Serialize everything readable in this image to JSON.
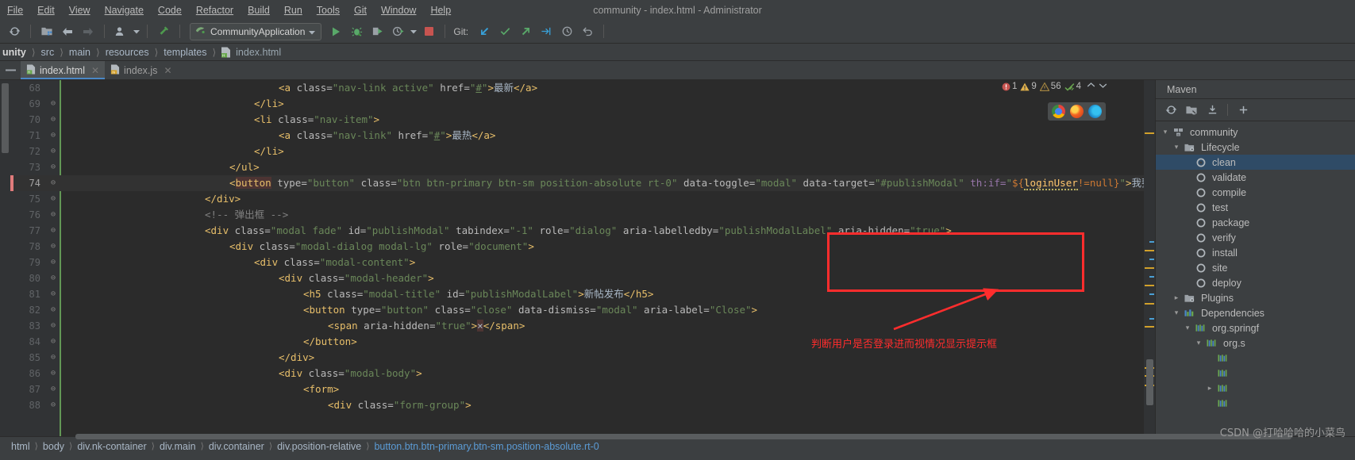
{
  "window": {
    "title": "community - index.html - Administrator"
  },
  "menubar": [
    {
      "label": "File",
      "mnemonic": "F"
    },
    {
      "label": "Edit",
      "mnemonic": "E"
    },
    {
      "label": "View",
      "mnemonic": "V"
    },
    {
      "label": "Navigate",
      "mnemonic": "N"
    },
    {
      "label": "Code",
      "mnemonic": "C"
    },
    {
      "label": "Refactor",
      "mnemonic": "R"
    },
    {
      "label": "Build",
      "mnemonic": "B"
    },
    {
      "label": "Run",
      "mnemonic": "u"
    },
    {
      "label": "Tools",
      "mnemonic": "T"
    },
    {
      "label": "Git",
      "mnemonic": "G"
    },
    {
      "label": "Window",
      "mnemonic": "W"
    },
    {
      "label": "Help",
      "mnemonic": "H"
    }
  ],
  "toolbar": {
    "run_config": "CommunityApplication",
    "git_label": "Git:",
    "icons": [
      "sync-icon",
      "project-structure-icon",
      "back-arrow-icon",
      "forward-arrow-icon",
      "profile-icon",
      "build-hammer-icon",
      "run-icon",
      "debug-icon",
      "run-coverage-icon",
      "profiler-icon",
      "stop-icon",
      "update-project-icon",
      "commit-icon",
      "push-icon",
      "rebase-icon",
      "history-icon",
      "rollback-icon"
    ]
  },
  "pathbar": {
    "crumbs": [
      "unity",
      "src",
      "main",
      "resources",
      "templates"
    ],
    "file": "index.html"
  },
  "tabs": [
    {
      "label": "index.html",
      "type": "html",
      "active": true
    },
    {
      "label": "index.js",
      "type": "js",
      "active": false
    }
  ],
  "inspections": {
    "errors": "1",
    "warnings": "9",
    "weak_warnings": "56",
    "typos": "4"
  },
  "browsers": [
    "chrome-icon",
    "firefox-icon",
    "edge-icon"
  ],
  "editor": {
    "first_line": 68,
    "lines": [
      {
        "n": 68,
        "indent": 0,
        "html": "<span class='t-tag'>&lt;a</span> <span class='t-attr'>class=</span><span class='t-str'>\"nav-link active\"</span> <span class='t-attr'>href=</span><span class='t-str'>\"</span><span class='t-link'>#</span><span class='t-str'>\"</span><span class='t-tag'>&gt;</span><span class='t-cn'>最新</span><span class='t-tag'>&lt;/a&gt;</span>",
        "pad": 268
      },
      {
        "n": 69,
        "indent": 0,
        "html": "<span class='t-tag'>&lt;/li&gt;</span>",
        "pad": 237
      },
      {
        "n": 70,
        "indent": 0,
        "html": "<span class='t-tag'>&lt;li</span> <span class='t-attr'>class=</span><span class='t-str'>\"nav-item\"</span><span class='t-tag'>&gt;</span>",
        "pad": 237
      },
      {
        "n": 71,
        "indent": 0,
        "html": "<span class='t-tag'>&lt;a</span> <span class='t-attr'>class=</span><span class='t-str'>\"nav-link\"</span> <span class='t-attr'>href=</span><span class='t-str'>\"</span><span class='t-link'>#</span><span class='t-str'>\"</span><span class='t-tag'>&gt;</span><span class='t-cn'>最热</span><span class='t-tag'>&lt;/a&gt;</span>",
        "pad": 268
      },
      {
        "n": 72,
        "indent": 0,
        "html": "<span class='t-tag'>&lt;/li&gt;</span>",
        "pad": 237
      },
      {
        "n": 73,
        "indent": 0,
        "html": "<span class='t-tag'>&lt;/ul&gt;</span>",
        "pad": 206
      },
      {
        "n": 74,
        "indent": 0,
        "current": true,
        "html": "<span class='t-tag'>&lt;</span><span class='t-err t-tag'>button</span> <span class='t-attr'>type=</span><span class='t-str'>\"button\"</span> <span class='t-attr'>class=</span><span class='t-str'>\"btn btn-primary btn-sm position-absolute rt-0\"</span> <span class='t-attr'>data-toggle=</span><span class='t-str'>\"modal\"</span> <span class='t-attr'>data-target=</span><span class='t-str'>\"#publishModal\"</span> <span class='t-ns'>th:if=</span><span class='t-str'>\"</span><span class='t-el'>${</span><span class='t-elv t-squig'>loginUser</span><span class='t-el'>!=</span><span class='t-el'>null}</span><span class='t-str'>\"</span><span class='t-tag'>&gt;</span><span class='t-cn'>我要发布</span><span class='t-err t-tag'>&lt;/button</span><span class='t-tag'>&gt;</span>",
        "pad": 206
      },
      {
        "n": 75,
        "indent": 0,
        "html": "<span class='t-tag'>&lt;/div&gt;</span>",
        "pad": 175
      },
      {
        "n": 76,
        "indent": 0,
        "html": "<span class='t-cmt'>&lt;!-- 弹出框 --&gt;</span>",
        "pad": 175
      },
      {
        "n": 77,
        "indent": 0,
        "html": "<span class='t-tag'>&lt;div</span> <span class='t-attr'>class=</span><span class='t-str'>\"modal fade\"</span> <span class='t-attr'>id=</span><span class='t-str'>\"publishModal\"</span> <span class='t-attr'>tabindex=</span><span class='t-str'>\"-1\"</span> <span class='t-attr'>role=</span><span class='t-str'>\"dialog\"</span> <span class='t-attr'>aria-labelledby=</span><span class='t-str'>\"publishModalLabel\"</span> <span class='t-attr'>aria-hidden=</span><span class='t-str'>\"true\"</span><span class='t-tag'>&gt;</span>",
        "pad": 175
      },
      {
        "n": 78,
        "indent": 0,
        "html": "<span class='t-tag'>&lt;div</span> <span class='t-attr'>class=</span><span class='t-str'>\"modal-dialog modal-lg\"</span> <span class='t-attr'>role=</span><span class='t-str'>\"document\"</span><span class='t-tag'>&gt;</span>",
        "pad": 206
      },
      {
        "n": 79,
        "indent": 0,
        "html": "<span class='t-tag'>&lt;div</span> <span class='t-attr'>class=</span><span class='t-str'>\"modal-content\"</span><span class='t-tag'>&gt;</span>",
        "pad": 237
      },
      {
        "n": 80,
        "indent": 0,
        "html": "<span class='t-tag'>&lt;div</span> <span class='t-attr'>class=</span><span class='t-str'>\"modal-header\"</span><span class='t-tag'>&gt;</span>",
        "pad": 268
      },
      {
        "n": 81,
        "indent": 0,
        "html": "<span class='t-tag'>&lt;h5</span> <span class='t-attr'>class=</span><span class='t-str'>\"modal-title\"</span> <span class='t-attr'>id=</span><span class='t-str'>\"publishModalLabel\"</span><span class='t-tag'>&gt;</span><span class='t-cn'>新帖发布</span><span class='t-tag'>&lt;/h5&gt;</span>",
        "pad": 299
      },
      {
        "n": 82,
        "indent": 0,
        "html": "<span class='t-tag'>&lt;button</span> <span class='t-attr'>type=</span><span class='t-str'>\"button\"</span> <span class='t-attr'>class=</span><span class='t-str'>\"close\"</span> <span class='t-attr'>data-dismiss=</span><span class='t-str'>\"modal\"</span> <span class='t-attr'>aria-label=</span><span class='t-str'>\"Close\"</span><span class='t-tag'>&gt;</span>",
        "pad": 299
      },
      {
        "n": 83,
        "indent": 0,
        "html": "<span class='t-tag'>&lt;span</span> <span class='t-attr'>aria-hidden=</span><span class='t-str'>\"true\"</span><span class='t-tag'>&gt;</span><span class='t-err t-txt'>×</span><span class='t-tag'>&lt;/span&gt;</span>",
        "pad": 330
      },
      {
        "n": 84,
        "indent": 0,
        "html": "<span class='t-tag'>&lt;/button&gt;</span>",
        "pad": 299
      },
      {
        "n": 85,
        "indent": 0,
        "html": "<span class='t-tag'>&lt;/div&gt;</span>",
        "pad": 268
      },
      {
        "n": 86,
        "indent": 0,
        "html": "<span class='t-tag'>&lt;div</span> <span class='t-attr'>class=</span><span class='t-str'>\"modal-body\"</span><span class='t-tag'>&gt;</span>",
        "pad": 268
      },
      {
        "n": 87,
        "indent": 0,
        "html": "<span class='t-tag'>&lt;form&gt;</span>",
        "pad": 299
      },
      {
        "n": 88,
        "indent": 0,
        "html": "<span class='t-tag'>&lt;div</span> <span class='t-attr'>class=</span><span class='t-str'>\"form-group\"</span><span class='t-tag'>&gt;</span>",
        "pad": 330
      }
    ]
  },
  "annotation": {
    "text": "判断用户是否登录进而视情况显示提示框",
    "color": "#ff2d2d"
  },
  "maven": {
    "title": "Maven",
    "toolbar_icons": [
      "reload-icon",
      "toggle-offline-icon",
      "download-sources-icon",
      "add-icon"
    ],
    "tree": [
      {
        "label": "community",
        "depth": 0,
        "arrow": "v",
        "icon": "maven-project-icon",
        "selected": false
      },
      {
        "label": "Lifecycle",
        "depth": 1,
        "arrow": "v",
        "icon": "lifecycle-folder-icon",
        "selected": false
      },
      {
        "label": "clean",
        "depth": 2,
        "arrow": "",
        "icon": "goal-gear-icon",
        "selected": true
      },
      {
        "label": "validate",
        "depth": 2,
        "arrow": "",
        "icon": "goal-gear-icon",
        "selected": false
      },
      {
        "label": "compile",
        "depth": 2,
        "arrow": "",
        "icon": "goal-gear-icon",
        "selected": false
      },
      {
        "label": "test",
        "depth": 2,
        "arrow": "",
        "icon": "goal-gear-icon",
        "selected": false
      },
      {
        "label": "package",
        "depth": 2,
        "arrow": "",
        "icon": "goal-gear-icon",
        "selected": false
      },
      {
        "label": "verify",
        "depth": 2,
        "arrow": "",
        "icon": "goal-gear-icon",
        "selected": false
      },
      {
        "label": "install",
        "depth": 2,
        "arrow": "",
        "icon": "goal-gear-icon",
        "selected": false
      },
      {
        "label": "site",
        "depth": 2,
        "arrow": "",
        "icon": "goal-gear-icon",
        "selected": false
      },
      {
        "label": "deploy",
        "depth": 2,
        "arrow": "",
        "icon": "goal-gear-icon",
        "selected": false
      },
      {
        "label": "Plugins",
        "depth": 1,
        "arrow": ">",
        "icon": "plugins-folder-icon",
        "selected": false
      },
      {
        "label": "Dependencies",
        "depth": 1,
        "arrow": "v",
        "icon": "dependencies-icon",
        "selected": false
      },
      {
        "label": "org.springf",
        "depth": 2,
        "arrow": "v",
        "icon": "library-icon",
        "selected": false
      },
      {
        "label": "org.s",
        "depth": 3,
        "arrow": "v",
        "icon": "library-icon",
        "selected": false
      },
      {
        "label": "",
        "depth": 4,
        "arrow": "",
        "icon": "library-icon",
        "selected": false
      },
      {
        "label": "",
        "depth": 4,
        "arrow": "",
        "icon": "library-icon",
        "selected": false
      },
      {
        "label": "",
        "depth": 4,
        "arrow": ">",
        "icon": "library-icon",
        "selected": false
      },
      {
        "label": "",
        "depth": 4,
        "arrow": "",
        "icon": "library-icon",
        "selected": false
      }
    ]
  },
  "bottom_breadcrumb": [
    "html",
    "body",
    "div.nk-container",
    "div.main",
    "div.container",
    "div.position-relative",
    "button.btn.btn-primary.btn-sm.position-absolute.rt-0"
  ],
  "watermark": "CSDN @打哈哈哈的小菜鸟"
}
